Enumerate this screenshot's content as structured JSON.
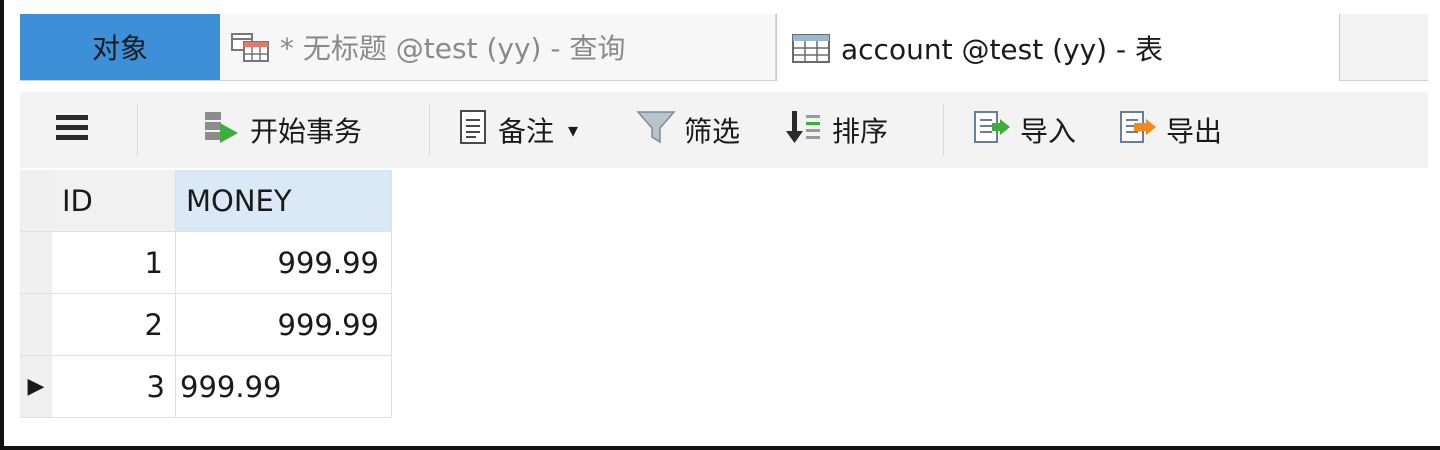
{
  "tabs": {
    "objects_label": "对象",
    "query_label": "* 无标题 @test (yy) - 查询",
    "table_label": "account @test (yy) - 表"
  },
  "toolbar": {
    "begin_transaction": "开始事务",
    "memo": "备注",
    "memo_dropdown": "▾",
    "filter": "筛选",
    "sort": "排序",
    "import": "导入",
    "export": "导出"
  },
  "table": {
    "columns": [
      "ID",
      "MONEY"
    ],
    "rows": [
      {
        "id": "1",
        "money": "999.99"
      },
      {
        "id": "2",
        "money": "999.99"
      },
      {
        "id": "3",
        "money": "999.99"
      }
    ],
    "current_row_marker": "▶"
  },
  "colors": {
    "active_tab": "#3d8fd8",
    "header_highlight": "#dbe9f6",
    "toolbar_bg": "#f3f3f3",
    "play_green": "#3cae3c",
    "export_orange": "#f08a1c"
  },
  "icons": {
    "menu": "hamburger-menu-icon",
    "begin_transaction": "begin-transaction-icon",
    "memo": "memo-document-icon",
    "filter": "filter-funnel-icon",
    "sort": "sort-icon",
    "import": "import-icon",
    "export": "export-icon"
  }
}
